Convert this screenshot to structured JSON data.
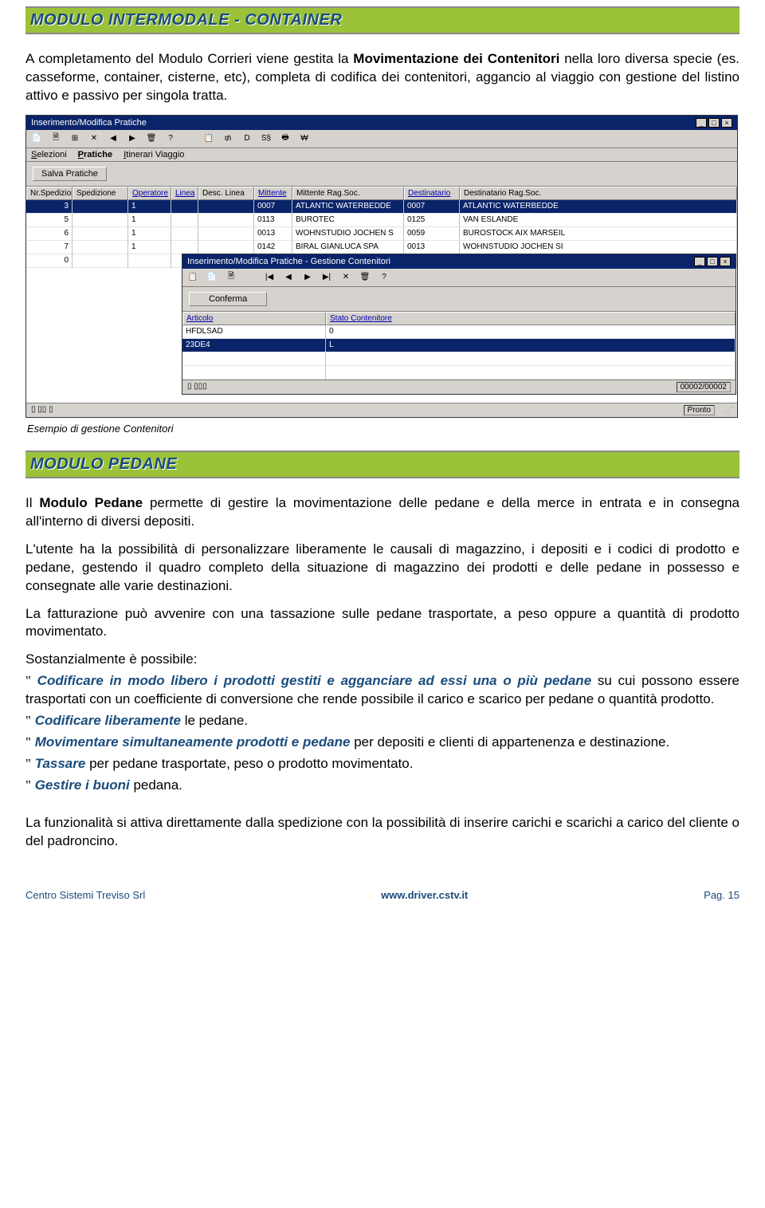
{
  "section1": {
    "title": "MODULO INTERMODALE -  CONTAINER",
    "p1_a": "A completamento del Modulo Corrieri viene gestita la ",
    "p1_b": "Movimentazione dei Contenitori",
    "p1_c": " nella loro diversa specie (es. casseforme, container, cisterne, etc), completa di codifica dei contenitori, aggancio al viaggio con gestione del listino attivo e passivo per singola tratta.",
    "caption": "Esempio di gestione Contenitori"
  },
  "screenshot": {
    "win1_title": "Inserimento/Modifica Pratiche",
    "menu": [
      "Selezioni",
      "Pratiche",
      "Itinerari Viaggio"
    ],
    "salva_btn": "Salva Pratiche",
    "headers": [
      "Nr.Spedizione",
      "Spedizione",
      "Operatore",
      "Linea",
      "Desc. Linea",
      "Mittente",
      "Mittente Rag.Soc.",
      "Destinatario",
      "Destinatario Rag.Soc."
    ],
    "rows": [
      {
        "sel": true,
        "c": [
          "3",
          "",
          "1",
          "",
          "",
          "0007",
          "ATLANTIC WATERBEDDE",
          "0007",
          "ATLANTIC WATERBEDDE"
        ]
      },
      {
        "sel": false,
        "c": [
          "5",
          "",
          "1",
          "",
          "",
          "0113",
          "BUROTEC",
          "0125",
          "VAN ESLANDE"
        ]
      },
      {
        "sel": false,
        "c": [
          "6",
          "",
          "1",
          "",
          "",
          "0013",
          "WOHNSTUDIO JOCHEN S",
          "0059",
          "BUROSTOCK AIX MARSEIL"
        ]
      },
      {
        "sel": false,
        "c": [
          "7",
          "",
          "1",
          "",
          "",
          "0142",
          "BIRAL GIANLUCA SPA",
          "0013",
          "WOHNSTUDIO JOCHEN SI"
        ]
      },
      {
        "sel": false,
        "c": [
          "0",
          "",
          "",
          "",
          "",
          "",
          "",
          "",
          ""
        ]
      }
    ],
    "win2_title": "Inserimento/Modifica Pratiche - Gestione Contenitori",
    "conferma_btn": "Conferma",
    "headers2": [
      "Articolo",
      "Stato Contenitore"
    ],
    "rows2": [
      {
        "sel": false,
        "c": [
          "HFDLSAD",
          "0"
        ]
      },
      {
        "sel": true,
        "c": [
          "23DE4",
          "L"
        ]
      }
    ],
    "status2_right": "00002/00002",
    "status1_right": "Pronto",
    "toolbar_icons": [
      "📄",
      "🗎",
      "⊞",
      "✕",
      "◀",
      "▶",
      "🗑",
      "?",
      "",
      "📋",
      "₥",
      "D",
      "S§",
      "🖶",
      "₩"
    ],
    "toolbar2_icons": [
      "📋",
      "📄",
      "🗎",
      "",
      "|◀",
      "◀",
      "▶",
      "▶|",
      "✕",
      "🗑",
      "?"
    ]
  },
  "section2": {
    "title": "MODULO PEDANE",
    "p1_a": "Il ",
    "p1_b": "Modulo Pedane",
    "p1_c": " permette di gestire la movimentazione delle pedane e della merce in entrata e in consegna all'interno di diversi depositi.",
    "p2": "L'utente ha la possibilità di personalizzare liberamente le causali di magazzino, i depositi e i codici di prodotto e pedane, gestendo il quadro completo della situazione di magazzino dei prodotti e delle pedane in possesso e consegnate alle varie destinazioni.",
    "p3": "La fatturazione può avvenire con una tassazione sulle pedane trasportate, a peso oppure a quantità di prodotto movimentato.",
    "p4": "Sostanzialmente è possibile:",
    "items": [
      {
        "em": "Codificare in modo libero i prodotti gestiti e agganciare ad essi una o più pedane",
        "rest": " su cui possono essere trasportati con un coefficiente di conversione che rende possibile il carico e scarico per pedane o quantità prodotto."
      },
      {
        "em": "Codificare liberamente",
        "rest": " le pedane."
      },
      {
        "em": "Movimentare simultaneamente prodotti e pedane",
        "rest": " per depositi e clienti di appartenenza e destinazione."
      },
      {
        "em": "Tassare",
        "rest": " per pedane trasportate, peso o prodotto movimentato."
      },
      {
        "em": "Gestire i buoni",
        "rest": " pedana."
      }
    ],
    "p5": "La funzionalità si attiva direttamente dalla spedizione con la possibilità di inserire carichi e scarichi a carico del cliente o del padroncino."
  },
  "footer": {
    "left": "Centro Sistemi Treviso Srl",
    "mid": "www.driver.cstv.it",
    "right": "Pag. 15"
  }
}
